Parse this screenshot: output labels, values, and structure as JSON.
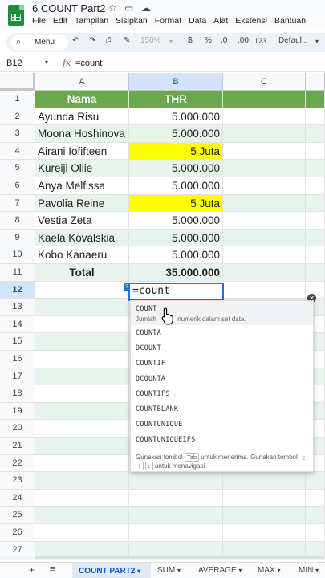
{
  "doc": {
    "title": "6 COUNT Part2",
    "menu": [
      "File",
      "Edit",
      "Tampilan",
      "Sisipkan",
      "Format",
      "Data",
      "Alat",
      "Ekstensi",
      "Bantuan"
    ]
  },
  "toolbar": {
    "menu_search": "Menu",
    "zoom": "150%",
    "currency": "$",
    "percent": "%",
    "dec_decrease": ".0",
    "dec_increase": ".00",
    "number_format": "123",
    "font": "Defaul..."
  },
  "formula_bar": {
    "name_box": "B12",
    "fx": "fx",
    "value": "=count"
  },
  "columns": [
    "A",
    "B",
    "C"
  ],
  "rows": [
    {
      "num": "1",
      "a": "Nama",
      "b": "THR"
    },
    {
      "num": "2",
      "a": "Ayunda Risu",
      "b": "5.000.000"
    },
    {
      "num": "3",
      "a": "Moona Hoshinova",
      "b": "5.000.000"
    },
    {
      "num": "4",
      "a": "Airani Iofifteen",
      "b": "5 Juta"
    },
    {
      "num": "5",
      "a": "Kureiji Ollie",
      "b": "5.000.000"
    },
    {
      "num": "6",
      "a": "Anya Melfissa",
      "b": "5.000.000"
    },
    {
      "num": "7",
      "a": "Pavolia Reine",
      "b": "5 Juta"
    },
    {
      "num": "8",
      "a": "Vestia Zeta",
      "b": "5.000.000"
    },
    {
      "num": "9",
      "a": "Kaela Kovalskia",
      "b": "5.000.000"
    },
    {
      "num": "10",
      "a": "Kobo Kanaeru",
      "b": "5.000.000"
    },
    {
      "num": "11",
      "a": "Total",
      "b": "35.000.000"
    },
    {
      "num": "12",
      "a": "",
      "b": ""
    },
    {
      "num": "13",
      "a": "",
      "b": ""
    },
    {
      "num": "14",
      "a": "",
      "b": ""
    },
    {
      "num": "15",
      "a": "",
      "b": ""
    },
    {
      "num": "16",
      "a": "",
      "b": ""
    },
    {
      "num": "17",
      "a": "",
      "b": ""
    },
    {
      "num": "18",
      "a": "",
      "b": ""
    },
    {
      "num": "19",
      "a": "",
      "b": ""
    },
    {
      "num": "20",
      "a": "",
      "b": ""
    },
    {
      "num": "21",
      "a": "",
      "b": ""
    },
    {
      "num": "22",
      "a": "",
      "b": ""
    },
    {
      "num": "23",
      "a": "",
      "b": ""
    },
    {
      "num": "24",
      "a": "",
      "b": ""
    },
    {
      "num": "25",
      "a": "",
      "b": ""
    },
    {
      "num": "26",
      "a": "",
      "b": ""
    },
    {
      "num": "27",
      "a": "",
      "b": ""
    }
  ],
  "active_cell": {
    "value": "=count",
    "help": "?"
  },
  "autocomplete": {
    "first": "COUNT",
    "first_desc_a": "Jumlah",
    "first_desc_b": "numerik dalam set data.",
    "items": [
      "COUNTA",
      "DCOUNT",
      "COUNTIF",
      "DCOUNTA",
      "COUNTIFS",
      "COUNTBLANK",
      "COUNTUNIQUE",
      "COUNTUNIQUEIFS"
    ],
    "footer_a": "Gunakan tombol",
    "footer_key": "Tab",
    "footer_b": "untuk menerima. Gunakan tombol",
    "footer_c": "untuk menavigasi"
  },
  "sheet_tabs": {
    "active": "COUNT PART2",
    "others": [
      "SUM",
      "AVERAGE",
      "MAX",
      "MIN"
    ]
  },
  "colors": {
    "header_green": "#6aa84f",
    "alt_row": "#e7f4ec",
    "highlight": "#ffff00",
    "accent": "#1a73e8"
  }
}
